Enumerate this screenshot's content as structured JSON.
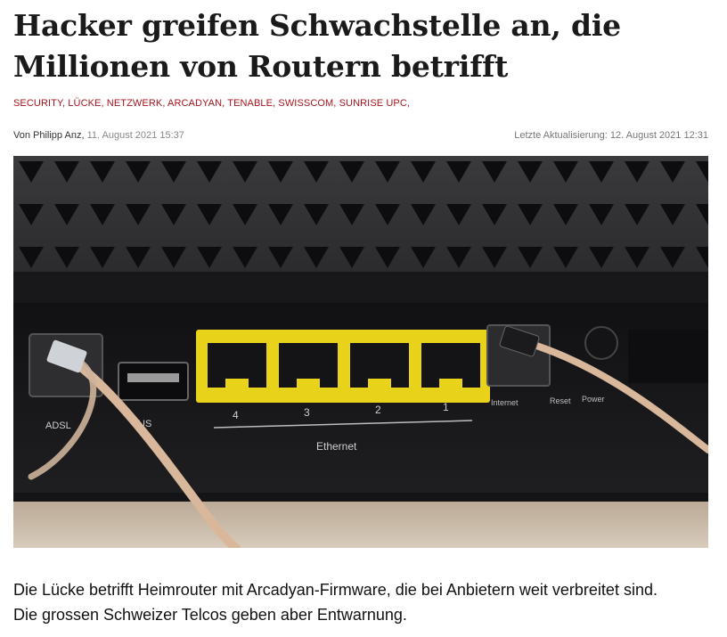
{
  "article": {
    "headline": "Hacker greifen Schwachstelle an, die Millionen von Routern betrifft",
    "tags": [
      "SECURITY",
      "LÜCKE",
      "NETZWERK",
      "ARCADYAN",
      "TENABLE",
      "SWISSCOM",
      "SUNRISE UPC"
    ],
    "tags_text": "SECURITY, LÜCKE, NETZWERK, ARCADYAN, TENABLE, SWISSCOM, SUNRISE UPC,",
    "author_prefix": "Von Philipp Anz,",
    "published": "11. August 2021 15:37",
    "updated_prefix": "Letzte Aktualisierung:",
    "updated": "12. August 2021 12:31",
    "lede": "Die Lücke betrifft Heimrouter mit Arcadyan-Firmware, die bei Anbietern weit verbreitet sind. Die grossen Schweizer Telcos geben aber Entwarnung."
  },
  "hero_image": {
    "port_labels": [
      "4",
      "3",
      "2",
      "1"
    ],
    "group_label": "Ethernet",
    "left_labels": [
      "ADSL",
      "US"
    ],
    "right_labels": [
      "Internet",
      "Reset",
      "Power"
    ]
  },
  "colors": {
    "tag_red": "#a8141c",
    "port_yellow": "#e8d21a",
    "router_black": "#1c1c1e"
  }
}
